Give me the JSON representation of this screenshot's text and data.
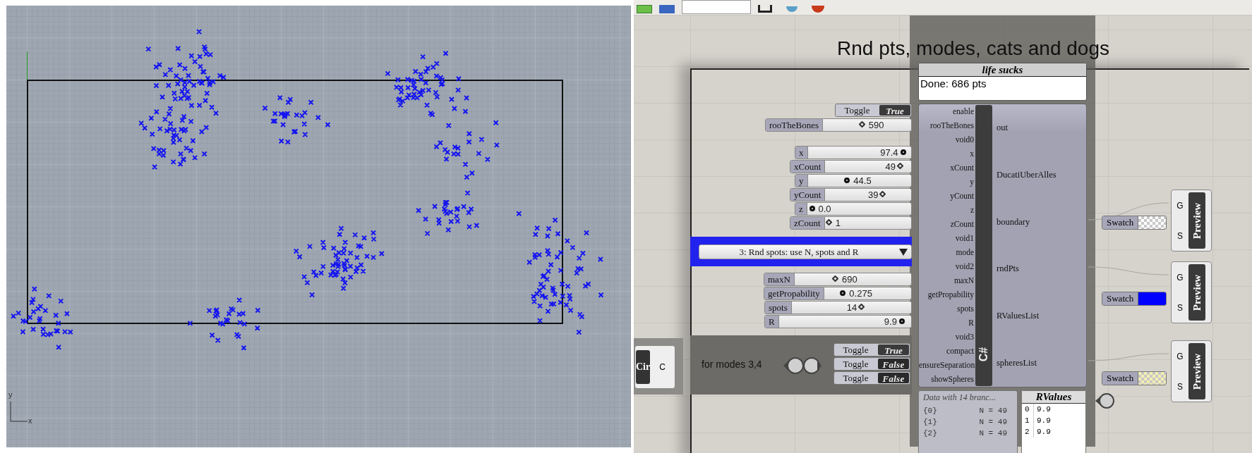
{
  "viewport": {
    "axis_labels": [
      "y",
      "x"
    ]
  },
  "canvas": {
    "title": "Rnd pts, modes, cats and dogs",
    "toggle_top": {
      "label": "Toggle",
      "value": "True",
      "on": true
    },
    "sliders": [
      {
        "label": "rooTheBones",
        "value": "590",
        "level": 0.45,
        "kind": "integer"
      },
      {
        "label": "x",
        "value": "97.4",
        "level": 0.96,
        "kind": "float"
      },
      {
        "label": "xCount",
        "value": "49",
        "level": 0.92,
        "kind": "integer"
      },
      {
        "label": "y",
        "value": "44.5",
        "level": 0.38,
        "kind": "float"
      },
      {
        "label": "yCount",
        "value": "39",
        "level": 0.7,
        "kind": "integer"
      },
      {
        "label": "z",
        "value": "0.0",
        "level": 0.02,
        "kind": "float"
      },
      {
        "label": "zCount",
        "value": "1",
        "level": 0.02,
        "kind": "integer"
      },
      {
        "label": "maxN",
        "value": "690",
        "level": 0.35,
        "kind": "integer"
      },
      {
        "label": "getPropability",
        "value": "0.275",
        "level": 0.2,
        "kind": "float"
      },
      {
        "label": "spots",
        "value": "14",
        "level": 0.6,
        "kind": "integer"
      },
      {
        "label": "R",
        "value": "9.9",
        "level": 0.96,
        "kind": "float"
      }
    ],
    "dropdown": {
      "value": "3: Rnd spots: use N, spots and R"
    },
    "group": {
      "label": "for modes 3,4",
      "toggles": [
        {
          "label": "Toggle",
          "value": "True",
          "on": true
        },
        {
          "label": "Toggle",
          "value": "False",
          "on": false
        },
        {
          "label": "Toggle",
          "value": "False",
          "on": false
        }
      ]
    },
    "circle_component": {
      "label": "Cir",
      "output": "C"
    },
    "panel": {
      "title": "life sucks",
      "text": "Done: 686 pts"
    },
    "script_component": {
      "label": "C#",
      "inputs": [
        "enable",
        "rooTheBones",
        "void0",
        "x",
        "xCount",
        "y",
        "yCount",
        "z",
        "zCount",
        "void1",
        "mode",
        "void2",
        "maxN",
        "getPropability",
        "spots",
        "R",
        "void3",
        "compact",
        "ensureSeparation",
        "showSpheres"
      ],
      "outputs": [
        "out",
        "DucatiUberAlles",
        "boundary",
        "rndPts",
        "RValuesList",
        "spheresList"
      ]
    },
    "data_panel": {
      "title": "Data with 14 branc...",
      "rows": [
        {
          "path": "{0}",
          "value": "N = 49"
        },
        {
          "path": "{1}",
          "value": "N = 49"
        },
        {
          "path": "{2}",
          "value": "N = 49"
        }
      ]
    },
    "rvalues_panel": {
      "title": "RValues",
      "rows": [
        {
          "index": "0",
          "value": "9.9"
        },
        {
          "index": "1",
          "value": "9.9"
        },
        {
          "index": "2",
          "value": "9.9"
        }
      ]
    },
    "previews": [
      {
        "label": "Preview",
        "inputs": [
          "G",
          "S"
        ],
        "swatch": {
          "label": "Swatch",
          "kind": "checker",
          "color": "#ffffff"
        }
      },
      {
        "label": "Preview",
        "inputs": [
          "G",
          "S"
        ],
        "swatch": {
          "label": "Swatch",
          "kind": "solid",
          "color": "#0000ff"
        }
      },
      {
        "label": "Preview",
        "inputs": [
          "G",
          "S"
        ],
        "swatch": {
          "label": "Swatch",
          "kind": "checker",
          "color": "#f4efb0"
        }
      }
    ]
  }
}
